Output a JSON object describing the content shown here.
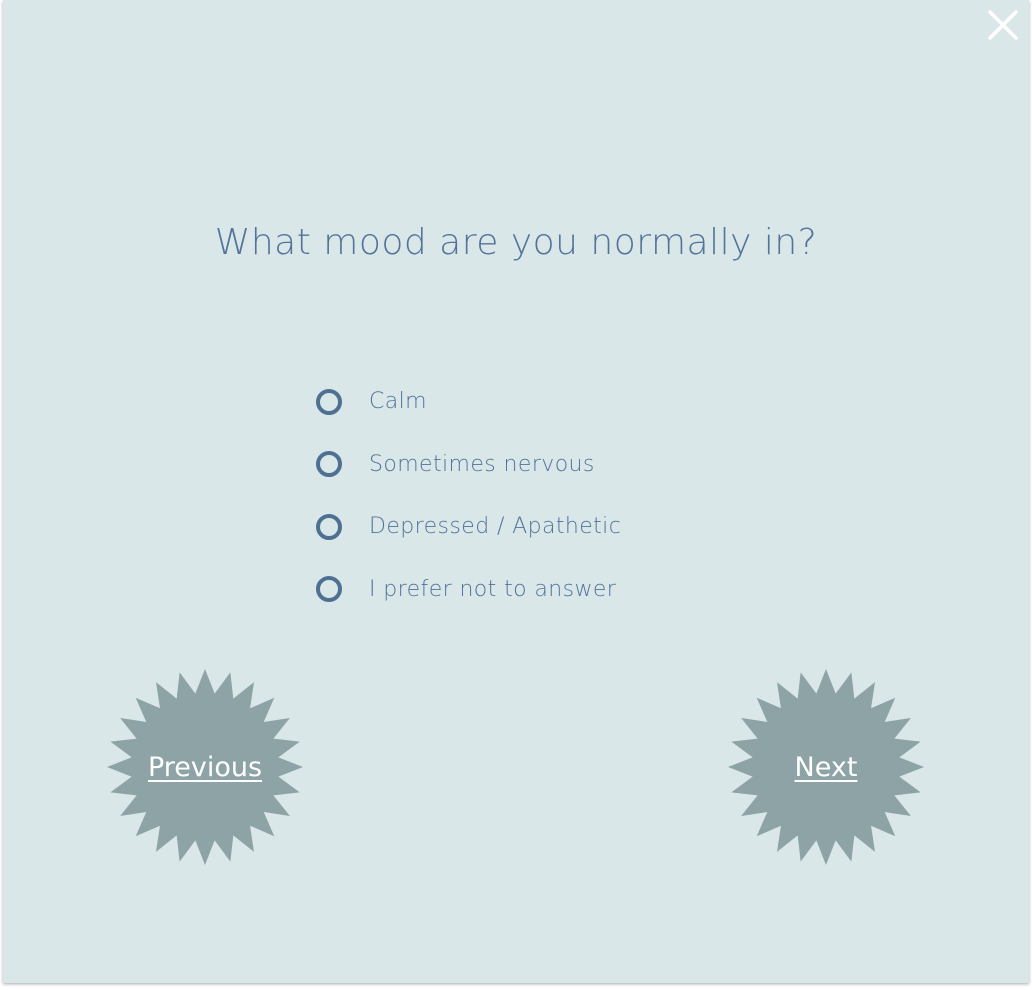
{
  "dialog": {
    "question": "What mood are you normally in?",
    "options": [
      {
        "label": "Calm"
      },
      {
        "label": "Sometimes nervous"
      },
      {
        "label": "Depressed / Apathetic"
      },
      {
        "label": "I prefer not to answer"
      }
    ],
    "previous_label": "Previous",
    "next_label": "Next",
    "close_icon": "close-icon"
  },
  "colors": {
    "background": "#d9e7e8",
    "text": "#52739a",
    "radio_border": "#4f7191",
    "burst_fill": "#8ea3a6",
    "button_text": "#ffffff",
    "close_icon": "#ffffff"
  }
}
